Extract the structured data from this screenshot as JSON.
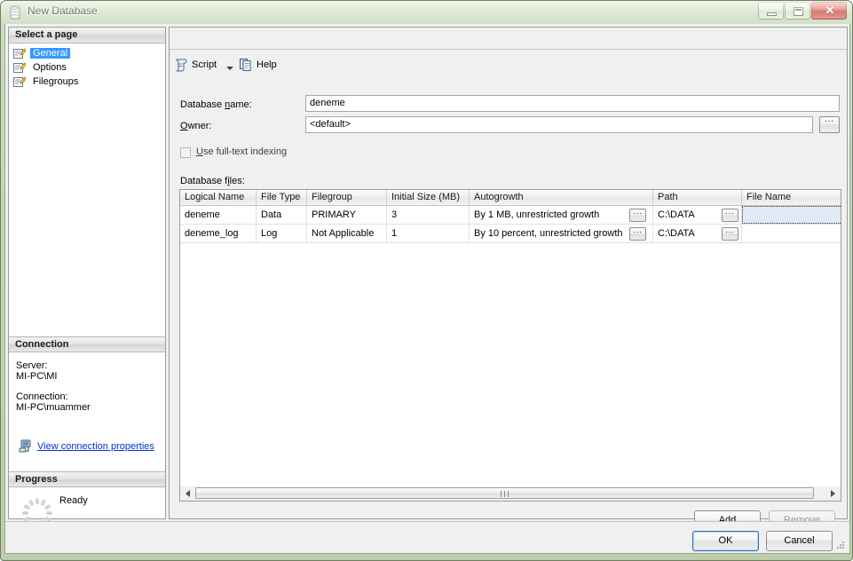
{
  "window": {
    "title": "New Database",
    "icon": "database-icon",
    "controls": {
      "minimize": "minimize-button",
      "maximize": "maximize-button",
      "close_glyph": "✕"
    }
  },
  "sidebar": {
    "select_header": "Select a page",
    "pages": [
      {
        "label": "General",
        "selected": true
      },
      {
        "label": "Options",
        "selected": false
      },
      {
        "label": "Filegroups",
        "selected": false
      }
    ],
    "connection": {
      "header": "Connection",
      "server_label": "Server:",
      "server_value": "MI-PC\\MI",
      "connection_label": "Connection:",
      "connection_value": "MI-PC\\muammer",
      "link": "View connection properties",
      "link_color": "#0033cc"
    },
    "progress": {
      "header": "Progress",
      "status": "Ready"
    }
  },
  "toolbar": {
    "script_label": "Script",
    "help_label": "Help"
  },
  "form": {
    "db_name_label": "Database name:",
    "db_name_value": "deneme",
    "owner_label": "Owner:",
    "owner_value": "<default>",
    "owner_browse_label": "...",
    "fulltext_label": "Use full-text indexing",
    "fulltext_checked": false,
    "db_files_label": "Database files:"
  },
  "grid": {
    "columns": [
      "Logical Name",
      "File Type",
      "Filegroup",
      "Initial Size (MB)",
      "Autogrowth",
      "Path",
      "File Name"
    ],
    "rows": [
      {
        "logical_name": "deneme",
        "file_type": "Data",
        "filegroup": "PRIMARY",
        "initial_size": "3",
        "autogrowth": "By 1 MB, unrestricted growth",
        "autogrowth_browse": "...",
        "path": "C:\\DATA",
        "path_browse": "...",
        "file_name": "",
        "file_name_selected": true
      },
      {
        "logical_name": "deneme_log",
        "file_type": "Log",
        "filegroup": "Not Applicable",
        "initial_size": "1",
        "autogrowth": "By 10 percent, unrestricted growth",
        "autogrowth_browse": "...",
        "path": "C:\\DATA",
        "path_browse": "...",
        "file_name": "",
        "file_name_selected": false
      }
    ]
  },
  "buttons": {
    "add": "Add",
    "remove": "Remove",
    "remove_disabled": true,
    "ok": "OK",
    "cancel": "Cancel",
    "ok_is_default": true
  }
}
